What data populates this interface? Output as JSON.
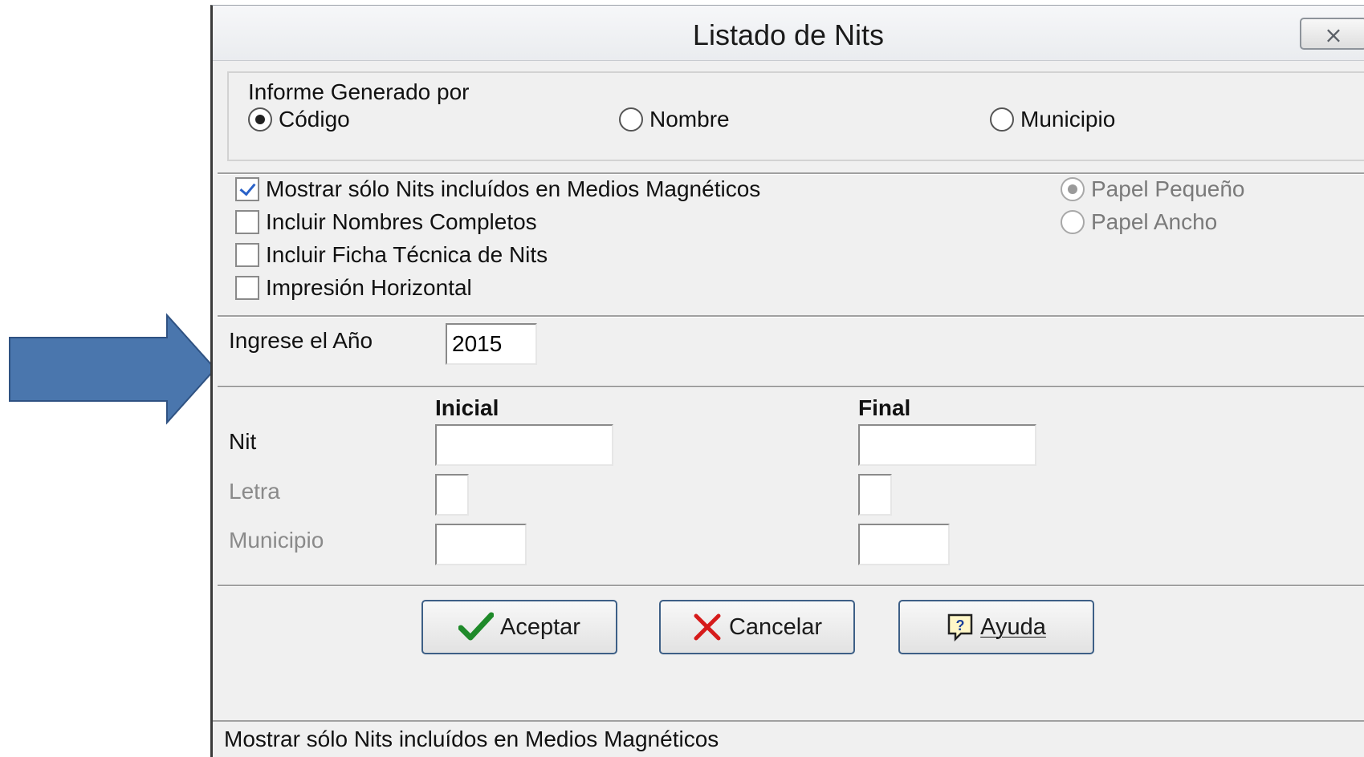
{
  "window": {
    "title": "Listado de Nits",
    "close_label": "⨯"
  },
  "report_group": {
    "label": "Informe Generado por",
    "options": [
      {
        "label": "Código",
        "selected": true
      },
      {
        "label": "Nombre",
        "selected": false
      },
      {
        "label": "Municipio",
        "selected": false
      }
    ]
  },
  "options": {
    "checks": [
      {
        "label": "Mostrar sólo Nits incluídos en Medios Magnéticos",
        "checked": true
      },
      {
        "label": "Incluir Nombres Completos",
        "checked": false
      },
      {
        "label": "Incluir Ficha Técnica de Nits",
        "checked": false
      },
      {
        "label": "Impresión Horizontal",
        "checked": false
      }
    ],
    "paper": [
      {
        "label": "Papel Pequeño",
        "selected": true,
        "disabled": true
      },
      {
        "label": "Papel Ancho",
        "selected": false,
        "disabled": true
      }
    ]
  },
  "year": {
    "label": "Ingrese el Año",
    "value": "2015"
  },
  "range": {
    "initial_header": "Inicial",
    "final_header": "Final",
    "rows": {
      "nit": "Nit",
      "letra": "Letra",
      "municipio": "Municipio"
    }
  },
  "buttons": {
    "accept": "Aceptar",
    "cancel": "Cancelar",
    "help": "Ayuda"
  },
  "status": {
    "text": "Mostrar sólo Nits incluídos en Medios Magnéticos"
  },
  "colors": {
    "arrow": "#4a76ad",
    "check_accent": "#2a62c8",
    "button_border": "#3d5f86"
  }
}
